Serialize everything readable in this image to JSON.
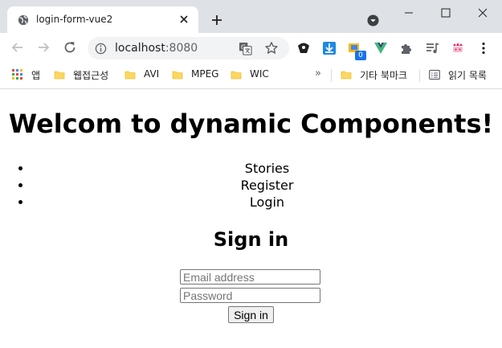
{
  "browser": {
    "tab": {
      "title": "login-form-vue2",
      "favicon": "globe-icon"
    },
    "address": {
      "host": "localhost",
      "port": ":8080"
    },
    "icons": {
      "back": "back-arrow-icon",
      "forward": "forward-arrow-icon",
      "reload": "reload-icon",
      "info": "info-icon",
      "translate": "translate-icon",
      "star": "star-icon"
    },
    "extension_badge": "0"
  },
  "bookmarks": {
    "apps": "앱",
    "items": [
      {
        "label": "웹접근성"
      },
      {
        "label": "AVI"
      },
      {
        "label": "MPEG"
      },
      {
        "label": "WIC"
      }
    ],
    "more": "»",
    "other": "기타 북마크",
    "reading_list": "읽기 목록"
  },
  "page": {
    "heading": "Welcom to dynamic Components!",
    "nav": [
      "Stories",
      "Register",
      "Login"
    ],
    "form": {
      "title": "Sign in",
      "email_placeholder": "Email address",
      "password_placeholder": "Password",
      "submit": "Sign in"
    }
  }
}
